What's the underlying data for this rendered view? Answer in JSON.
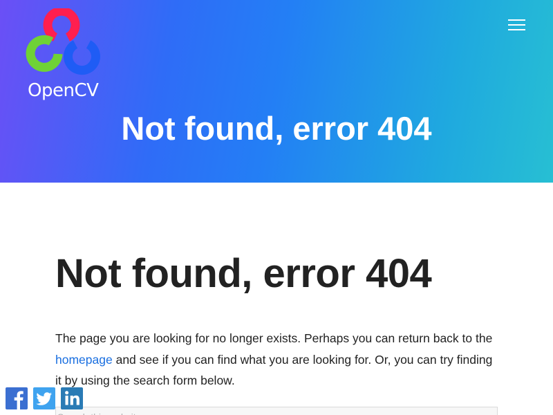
{
  "brand": {
    "name": "OpenCV",
    "colors": {
      "red": "#ff1f4f",
      "green": "#6fd236",
      "blue": "#1f5cf5"
    }
  },
  "header": {
    "menu_icon": "hamburger-menu-icon",
    "hero_title": "Not found, error 404",
    "gradient": [
      "#6b4ff6",
      "#2f6cf7",
      "#237ff5",
      "#1fa9df",
      "#27bfd3"
    ]
  },
  "main": {
    "heading": "Not found, error 404",
    "intro_before_link": "The page you are looking for no longer exists. Perhaps you can return back to the ",
    "intro_link": "homepage",
    "intro_after_link": " and see if you can find what you are looking for. Or, you can try finding it by using the search form below.",
    "search_placeholder": "Search this website",
    "link_color": "#1a6fe0"
  },
  "social": [
    {
      "icon": "facebook-icon",
      "color": "#3b6fd1"
    },
    {
      "icon": "twitter-icon",
      "color": "#3fa3ef"
    },
    {
      "icon": "linkedin-icon",
      "color": "#2a7bb5"
    }
  ]
}
